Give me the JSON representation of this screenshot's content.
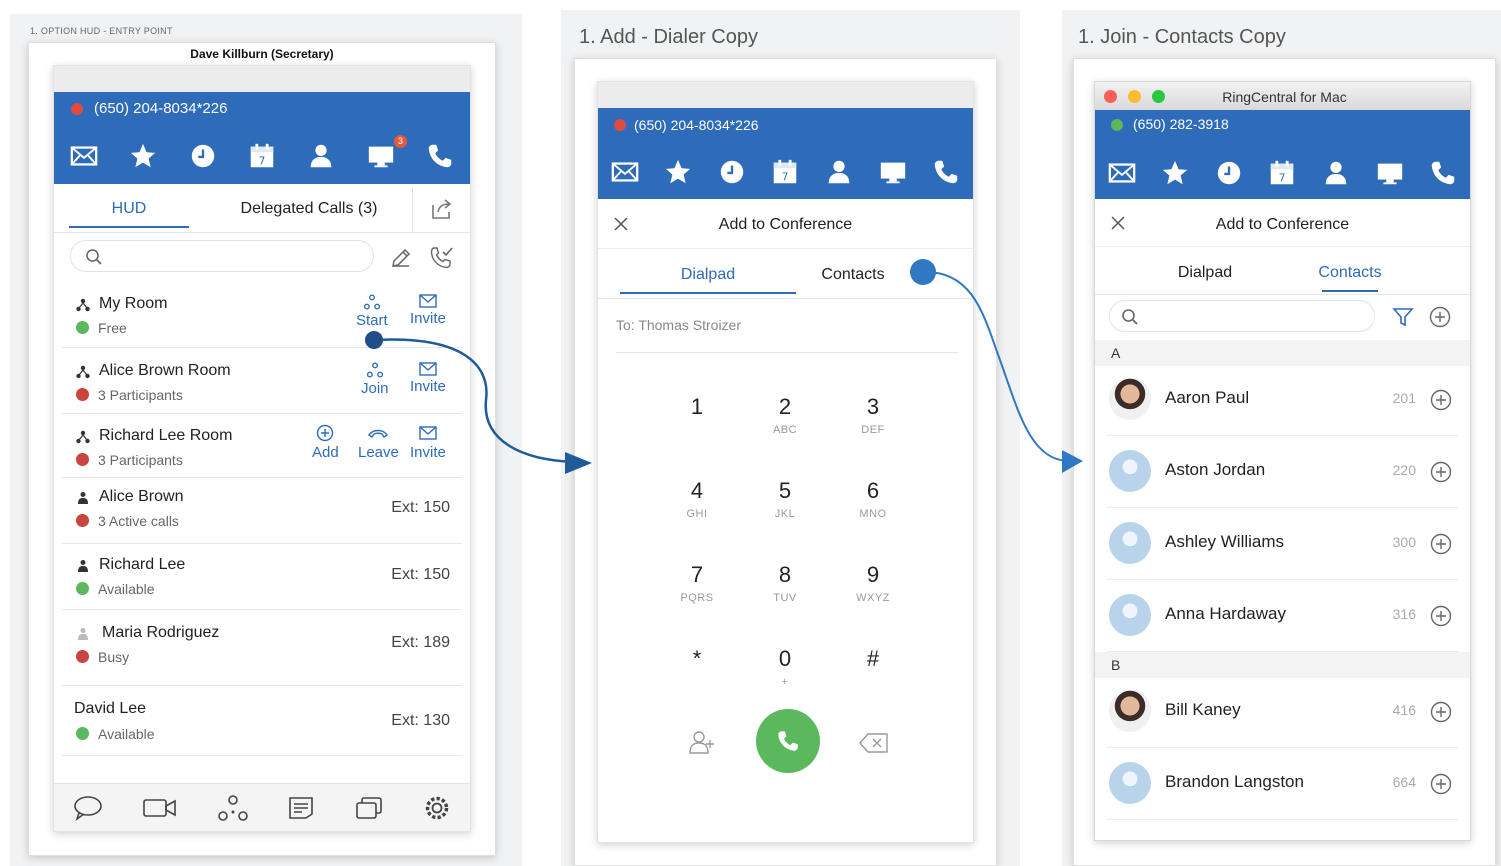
{
  "captions": {
    "hud": "1. OPTION HUD - ENTRY POINT",
    "dialer": "1. Add - Dialer Copy",
    "contacts": "1. Join - Contacts Copy"
  },
  "hud": {
    "owner": "Dave Killburn (Secretary)",
    "phone": "(650) 204-8034*226",
    "badge": "3",
    "tabs": [
      "HUD",
      "Delegated Calls (3)"
    ],
    "rows": [
      {
        "name": "My Room",
        "status": "Free",
        "status_color": "#5cb85c",
        "actions": [
          "Start",
          "Invite"
        ]
      },
      {
        "name": "Alice Brown Room",
        "status": "3 Participants",
        "status_color": "#c9453e",
        "actions": [
          "Join",
          "Invite"
        ]
      },
      {
        "name": "Richard Lee Room",
        "status": "3 Participants",
        "status_color": "#c9453e",
        "actions": [
          "Add",
          "Leave",
          "Invite"
        ]
      },
      {
        "name": "Alice Brown",
        "status": "3 Active calls",
        "status_color": "#c9453e",
        "ext": "Ext: 150"
      },
      {
        "name": "Richard Lee",
        "status": "Available",
        "status_color": "#5cb85c",
        "ext": "Ext: 150"
      },
      {
        "name": "Maria Rodriguez",
        "status": "Busy",
        "status_color": "#c9453e",
        "ext": "Ext: 189"
      },
      {
        "name": "David Lee",
        "status": "Available",
        "status_color": "#5cb85c",
        "ext": "Ext: 130"
      }
    ]
  },
  "dialer": {
    "phone": "(650) 204-8034*226",
    "title": "Add to Conference",
    "tabs": [
      "Dialpad",
      "Contacts"
    ],
    "to": "To: Thomas Stroizer",
    "keys": [
      {
        "d": "1",
        "l": ""
      },
      {
        "d": "2",
        "l": "ABC"
      },
      {
        "d": "3",
        "l": "DEF"
      },
      {
        "d": "4",
        "l": "GHI"
      },
      {
        "d": "5",
        "l": "JKL"
      },
      {
        "d": "6",
        "l": "MNO"
      },
      {
        "d": "7",
        "l": "PQRS"
      },
      {
        "d": "8",
        "l": "TUV"
      },
      {
        "d": "9",
        "l": "WXYZ"
      },
      {
        "d": "*",
        "l": ""
      },
      {
        "d": "0",
        "l": "+"
      },
      {
        "d": "#",
        "l": ""
      }
    ]
  },
  "contacts": {
    "window_title": "RingCentral for Mac",
    "phone": "(650) 282-3918",
    "title": "Add to Conference",
    "tabs": [
      "Dialpad",
      "Contacts"
    ],
    "sections": [
      {
        "letter": "A",
        "people": [
          {
            "name": "Aaron Paul",
            "ext": "201",
            "photo": true
          },
          {
            "name": "Aston Jordan",
            "ext": "220",
            "photo": false
          },
          {
            "name": "Ashley Williams",
            "ext": "300",
            "photo": false
          },
          {
            "name": "Anna Hardaway",
            "ext": "316",
            "photo": false
          }
        ]
      },
      {
        "letter": "B",
        "people": [
          {
            "name": "Bill Kaney",
            "ext": "416",
            "photo": true
          },
          {
            "name": "Brandon Langston",
            "ext": "664",
            "photo": false
          }
        ]
      }
    ]
  },
  "colors": {
    "brand_blue": "#2e6bb8",
    "call_green": "#5cb85c",
    "busy_red": "#c9453e",
    "flow_arrow": "#1f5a99"
  }
}
